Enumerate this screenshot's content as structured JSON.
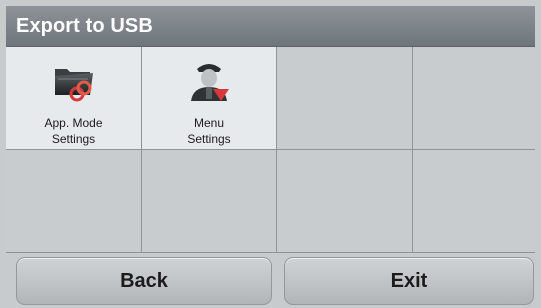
{
  "header": {
    "title": "Export to USB"
  },
  "grid": {
    "items": [
      {
        "label": "App. Mode\nSettings",
        "icon": "folder-link-icon",
        "selected": true
      },
      {
        "label": "Menu\nSettings",
        "icon": "user-download-icon",
        "selected": true
      }
    ]
  },
  "footer": {
    "back_label": "Back",
    "exit_label": "Exit"
  },
  "colors": {
    "title_bar": "#7a8085",
    "cell_active": "#e7eaec",
    "cell_inactive": "#c9cccf",
    "icon_red": "#d9383a"
  }
}
